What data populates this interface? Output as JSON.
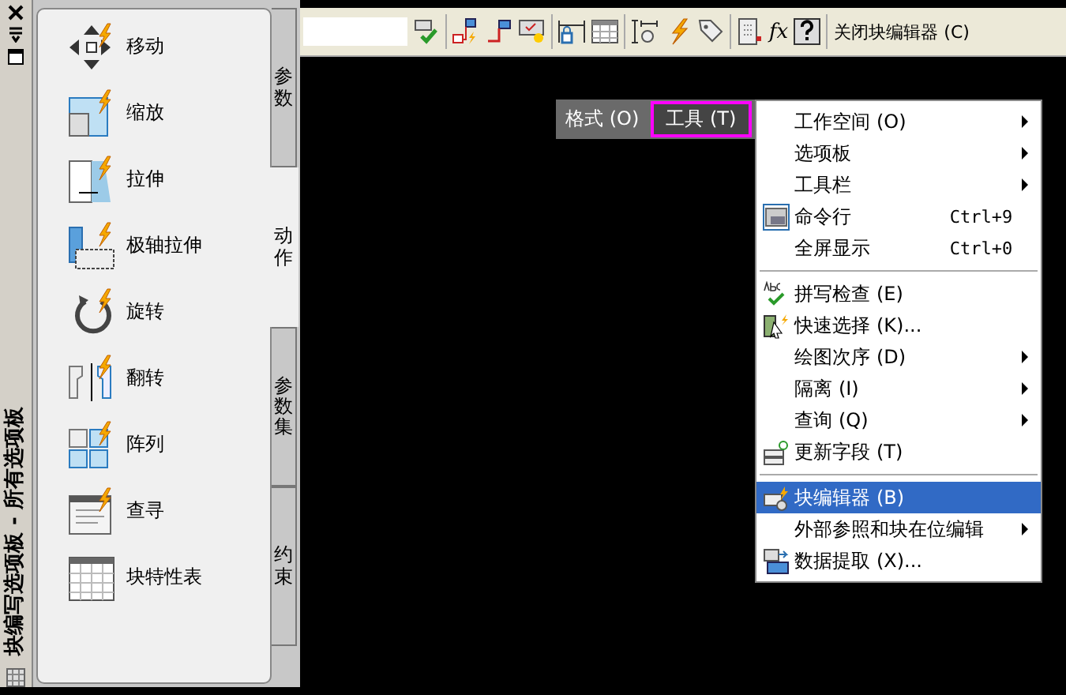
{
  "palette": {
    "title": "块编写选项板 - 所有选项板",
    "tools": [
      {
        "label": "移动"
      },
      {
        "label": "缩放"
      },
      {
        "label": "拉伸"
      },
      {
        "label": "极轴拉伸"
      },
      {
        "label": "旋转"
      },
      {
        "label": "翻转"
      },
      {
        "label": "阵列"
      },
      {
        "label": "查寻"
      },
      {
        "label": "块特性表"
      }
    ],
    "tabs": [
      {
        "label": "参数",
        "selected": false
      },
      {
        "label": "动作",
        "selected": true
      },
      {
        "label": "参数集",
        "selected": false
      },
      {
        "label": "约束",
        "selected": false
      }
    ]
  },
  "toolbar": {
    "function_label": "fx",
    "close_button": "关闭块编辑器 (C)"
  },
  "menubar": [
    {
      "label": "格式 (O)",
      "selected": false
    },
    {
      "label": "工具 (T)",
      "selected": true
    }
  ],
  "menu": [
    {
      "kind": "item",
      "label": "工作空间 (O)",
      "submenu": true,
      "selected": false
    },
    {
      "kind": "item",
      "label": "选项板",
      "submenu": true,
      "selected": false
    },
    {
      "kind": "item",
      "label": "工具栏",
      "submenu": true,
      "selected": false
    },
    {
      "kind": "item",
      "label": "命令行",
      "shortcut": "Ctrl+9",
      "submenu": false,
      "selected": false
    },
    {
      "kind": "item",
      "label": "全屏显示",
      "shortcut": "Ctrl+0",
      "submenu": false,
      "selected": false
    },
    {
      "kind": "separator"
    },
    {
      "kind": "item",
      "label": "拼写检查 (E)",
      "submenu": false,
      "selected": false
    },
    {
      "kind": "item",
      "label": "快速选择 (K)...",
      "submenu": false,
      "selected": false
    },
    {
      "kind": "item",
      "label": "绘图次序 (D)",
      "submenu": true,
      "selected": false
    },
    {
      "kind": "item",
      "label": "隔离 (I)",
      "submenu": true,
      "selected": false
    },
    {
      "kind": "item",
      "label": "查询 (Q)",
      "submenu": true,
      "selected": false
    },
    {
      "kind": "item",
      "label": "更新字段 (T)",
      "submenu": false,
      "selected": false
    },
    {
      "kind": "separator"
    },
    {
      "kind": "item",
      "label": "块编辑器 (B)",
      "submenu": false,
      "selected": true
    },
    {
      "kind": "item",
      "label": "外部参照和块在位编辑",
      "submenu": true,
      "selected": false
    },
    {
      "kind": "item",
      "label": "数据提取 (X)...",
      "submenu": false,
      "selected": false
    }
  ]
}
